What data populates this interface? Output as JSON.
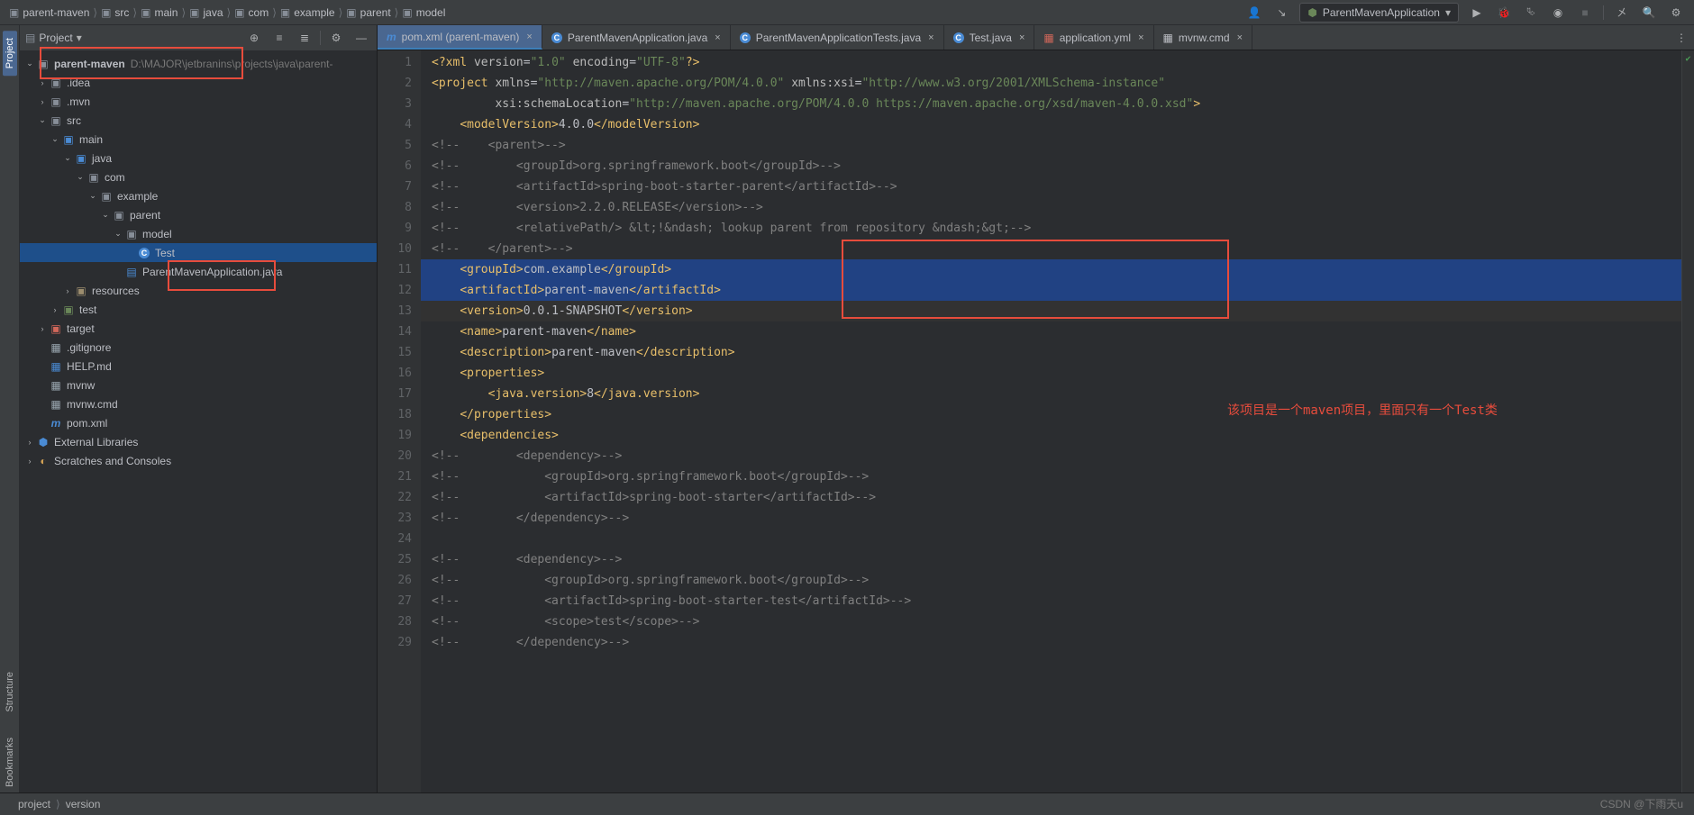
{
  "breadcrumbs": [
    "parent-maven",
    "src",
    "main",
    "java",
    "com",
    "example",
    "parent",
    "model"
  ],
  "runconfig_label": "ParentMavenApplication",
  "panel_title": "Project",
  "project_root": {
    "name": "parent-maven",
    "path": "D:\\MAJOR\\jetbranins\\projects\\java\\parent-"
  },
  "tree": {
    "idea": ".idea",
    "mvn": ".mvn",
    "src": "src",
    "main": "main",
    "java": "java",
    "com": "com",
    "example": "example",
    "parent": "parent",
    "model": "model",
    "test_class": "Test",
    "app_class": "ParentMavenApplication.java",
    "resources": "resources",
    "test": "test",
    "target": "target",
    "gitignore": ".gitignore",
    "help": "HELP.md",
    "mvnw": "mvnw",
    "mvnwcmd": "mvnw.cmd",
    "pom": "pom.xml",
    "extlib": "External Libraries",
    "scratches": "Scratches and Consoles"
  },
  "tabs": [
    {
      "label": "pom.xml (parent-maven)",
      "active": true,
      "icon": "m"
    },
    {
      "label": "ParentMavenApplication.java",
      "active": false,
      "icon": "c"
    },
    {
      "label": "ParentMavenApplicationTests.java",
      "active": false,
      "icon": "c"
    },
    {
      "label": "Test.java",
      "active": false,
      "icon": "c"
    },
    {
      "label": "application.yml",
      "active": false,
      "icon": "y"
    },
    {
      "label": "mvnw.cmd",
      "active": false,
      "icon": "f"
    }
  ],
  "code_lines": [
    {
      "n": 1,
      "html": "<span class='tk-tag'>&lt;?xml</span> <span class='tk-attr'>version</span>=<span class='tk-val'>\"1.0\"</span> <span class='tk-attr'>encoding</span>=<span class='tk-val'>\"UTF-8\"</span><span class='tk-tag'>?&gt;</span>"
    },
    {
      "n": 2,
      "html": "<span class='tk-tag'>&lt;project</span> <span class='tk-attr'>xmlns</span>=<span class='tk-val'>\"http://maven.apache.org/POM/4.0.0\"</span> <span class='tk-attr'>xmlns:</span><span class='tk-attr'>xsi</span>=<span class='tk-val'>\"http://www.w3.org/2001/XMLSchema-instance\"</span>"
    },
    {
      "n": 3,
      "html": "         <span class='tk-attr'>xsi:</span><span class='tk-attr'>schemaLocation</span>=<span class='tk-val'>\"http://maven.apache.org/POM/4.0.0 https://maven.apache.org/xsd/maven-4.0.0.xsd\"</span><span class='tk-tag'>&gt;</span>"
    },
    {
      "n": 4,
      "html": "    <span class='tk-tag'>&lt;modelVersion&gt;</span><span class='tk-text'>4.0.0</span><span class='tk-tag'>&lt;/modelVersion&gt;</span>"
    },
    {
      "n": 5,
      "html": "<span class='tk-comment'>&lt;!--    &lt;parent&gt;--&gt;</span>"
    },
    {
      "n": 6,
      "html": "<span class='tk-comment'>&lt;!--        &lt;groupId&gt;org.springframework.boot&lt;/groupId&gt;--&gt;</span>"
    },
    {
      "n": 7,
      "html": "<span class='tk-comment'>&lt;!--        &lt;artifactId&gt;spring-boot-starter-parent&lt;/artifactId&gt;--&gt;</span>"
    },
    {
      "n": 8,
      "html": "<span class='tk-comment'>&lt;!--        &lt;version&gt;2.2.0.RELEASE&lt;/version&gt;--&gt;</span>"
    },
    {
      "n": 9,
      "html": "<span class='tk-comment'>&lt;!--        &lt;relativePath/&gt; &amp;lt;!&amp;ndash; lookup parent from repository &amp;ndash;&amp;gt;--&gt;</span>"
    },
    {
      "n": 10,
      "html": "<span class='tk-comment'>&lt;!--    &lt;/parent&gt;--&gt;</span>"
    },
    {
      "n": 11,
      "sel": true,
      "html": "    <span class='tk-tag'>&lt;groupId&gt;</span><span class='tk-text'>com.example</span><span class='tk-tag'>&lt;/groupId&gt;</span>"
    },
    {
      "n": 12,
      "sel": true,
      "html": "    <span class='tk-tag'>&lt;artifactId&gt;</span><span class='tk-text'>parent-maven</span><span class='tk-tag'>&lt;/artifactId&gt;</span>"
    },
    {
      "n": 13,
      "sel": true,
      "caret": true,
      "html": "    <span class='tk-tag'>&lt;version&gt;</span><span class='tk-text'>0.0.1-SNAPSHOT</span><span class='tk-tag'>&lt;/version&gt;</span>"
    },
    {
      "n": 14,
      "html": "    <span class='tk-tag'>&lt;name&gt;</span><span class='tk-text'>parent-maven</span><span class='tk-tag'>&lt;/name&gt;</span>"
    },
    {
      "n": 15,
      "html": "    <span class='tk-tag'>&lt;description&gt;</span><span class='tk-text'>parent-maven</span><span class='tk-tag'>&lt;/description&gt;</span>"
    },
    {
      "n": 16,
      "html": "    <span class='tk-tag'>&lt;properties&gt;</span>"
    },
    {
      "n": 17,
      "html": "        <span class='tk-tag'>&lt;java.version&gt;</span><span class='tk-text'>8</span><span class='tk-tag'>&lt;/java.version&gt;</span>"
    },
    {
      "n": 18,
      "html": "    <span class='tk-tag'>&lt;/properties&gt;</span>"
    },
    {
      "n": 19,
      "html": "    <span class='tk-tag'>&lt;dependencies&gt;</span>"
    },
    {
      "n": 20,
      "html": "<span class='tk-comment'>&lt;!--        &lt;dependency&gt;--&gt;</span>"
    },
    {
      "n": 21,
      "html": "<span class='tk-comment'>&lt;!--            &lt;groupId&gt;org.springframework.boot&lt;/groupId&gt;--&gt;</span>"
    },
    {
      "n": 22,
      "html": "<span class='tk-comment'>&lt;!--            &lt;artifactId&gt;spring-boot-starter&lt;/artifactId&gt;--&gt;</span>"
    },
    {
      "n": 23,
      "html": "<span class='tk-comment'>&lt;!--        &lt;/dependency&gt;--&gt;</span>"
    },
    {
      "n": 24,
      "html": ""
    },
    {
      "n": 25,
      "html": "<span class='tk-comment'>&lt;!--        &lt;dependency&gt;--&gt;</span>"
    },
    {
      "n": 26,
      "html": "<span class='tk-comment'>&lt;!--            &lt;groupId&gt;org.springframework.boot&lt;/groupId&gt;--&gt;</span>"
    },
    {
      "n": 27,
      "html": "<span class='tk-comment'>&lt;!--            &lt;artifactId&gt;spring-boot-starter-test&lt;/artifactId&gt;--&gt;</span>"
    },
    {
      "n": 28,
      "html": "<span class='tk-comment'>&lt;!--            &lt;scope&gt;test&lt;/scope&gt;--&gt;</span>"
    },
    {
      "n": 29,
      "html": "<span class='tk-comment'>&lt;!--        &lt;/dependency&gt;--&gt;</span>"
    }
  ],
  "annotation": "该项目是一个maven项目，里面只有一个Test类",
  "crumbbar": [
    "project",
    "version"
  ],
  "watermark": "CSDN @下雨天u",
  "left_tabs": {
    "project": "Project",
    "bookmarks": "Bookmarks",
    "structure": "Structure"
  }
}
